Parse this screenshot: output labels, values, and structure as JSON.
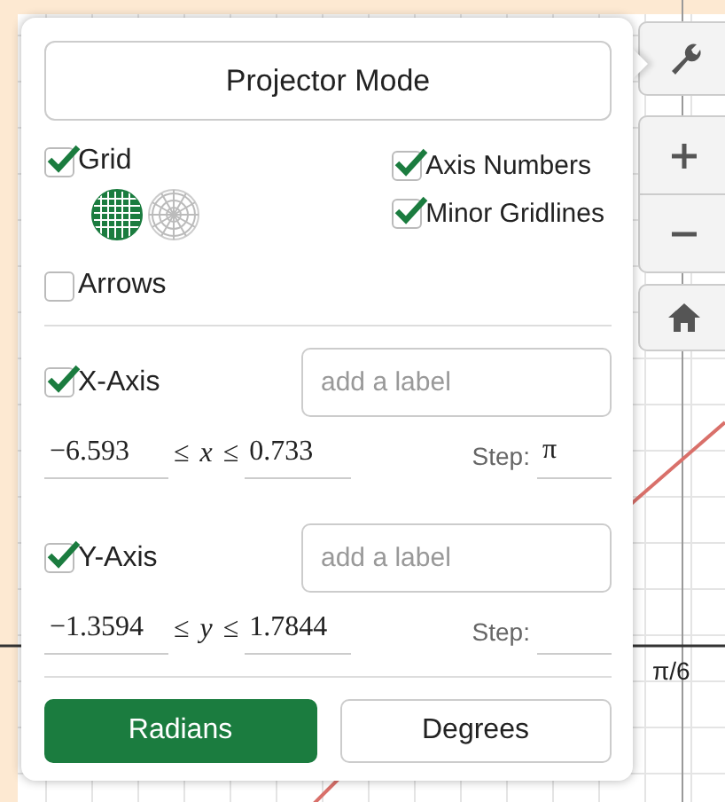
{
  "projector_mode_button": "Projector Mode",
  "left_options": [
    {
      "label": "Grid",
      "checked": true
    },
    {
      "label": "Arrows",
      "checked": false
    }
  ],
  "grid_types": [
    {
      "kind": "cartesian",
      "selected": true
    },
    {
      "kind": "polar",
      "selected": false
    }
  ],
  "right_options": [
    {
      "label": "Axis Numbers",
      "checked": true
    },
    {
      "label": "Minor Gridlines",
      "checked": true
    }
  ],
  "axes": [
    {
      "label": "X-Axis",
      "checked": true,
      "placeholder": "add a label",
      "min": "−6.593",
      "symbol": "≤",
      "variable": "x",
      "max": "0.733",
      "step_label": "Step:",
      "step": "π"
    },
    {
      "label": "Y-Axis",
      "checked": true,
      "placeholder": "add a label",
      "min": "−1.3594",
      "symbol": "≤",
      "variable": "y",
      "max": "1.7844",
      "step_label": "Step:"
    }
  ],
  "units": [
    {
      "label": "Radians",
      "selected": true
    },
    {
      "label": "Degrees",
      "selected": false
    }
  ],
  "graph": {
    "axis_label": "π/6"
  }
}
